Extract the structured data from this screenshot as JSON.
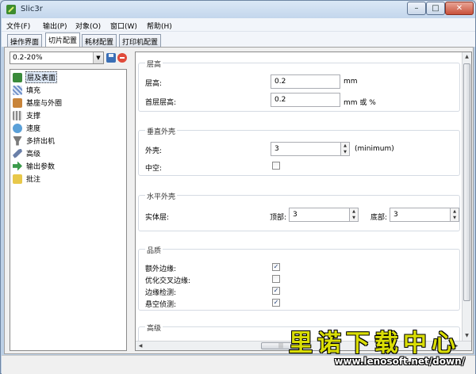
{
  "window": {
    "title": "Slic3r",
    "controls": {
      "minimize": "–",
      "maximize": "□",
      "close": "✕"
    }
  },
  "menubar": {
    "items": [
      "文件(F)",
      "输出(P)",
      "对象(O)",
      "窗口(W)",
      "帮助(H)"
    ]
  },
  "tabs": [
    "操作界面",
    "切片配置",
    "耗材配置",
    "打印机配置"
  ],
  "active_tab": "切片配置",
  "preset": {
    "value": "0.2-20%"
  },
  "page_tree": {
    "items": [
      {
        "label": "层及表面",
        "icon": "layers-icon",
        "color": "#3a8a3a"
      },
      {
        "label": "填充",
        "icon": "infill-icon",
        "color": "#6e8fc8"
      },
      {
        "label": "基座与外圈",
        "icon": "skirt-brim-icon",
        "color": "#c8843a"
      },
      {
        "label": "支撑",
        "icon": "support-icon",
        "color": "#8a8a8a"
      },
      {
        "label": "速度",
        "icon": "speed-icon",
        "color": "#5aa0d8"
      },
      {
        "label": "多挤出机",
        "icon": "extruder-icon",
        "color": "#7a7a7a"
      },
      {
        "label": "高级",
        "icon": "wrench-icon",
        "color": "#6a7fa8"
      },
      {
        "label": "输出参数",
        "icon": "output-icon",
        "color": "#3a9a4a"
      },
      {
        "label": "批注",
        "icon": "notes-icon",
        "color": "#e8c84a"
      }
    ]
  },
  "settings": {
    "layer_height": {
      "title": "层高",
      "layer_height_label": "层高:",
      "layer_height_value": "0.2",
      "layer_height_unit": "mm",
      "first_layer_label": "首层层高:",
      "first_layer_value": "0.2",
      "first_layer_unit": "mm 或 %"
    },
    "vertical_shells": {
      "title": "垂直外壳",
      "perimeters_label": "外壳:",
      "perimeters_value": "3",
      "perimeters_unit": "(minimum)",
      "hollow_label": "中空:",
      "hollow_checked": false
    },
    "horizontal_shells": {
      "title": "水平外壳",
      "solid_layers_label": "实体层:",
      "top_label": "顶部:",
      "top_value": "3",
      "bottom_label": "底部:",
      "bottom_value": "3"
    },
    "quality": {
      "title": "品质",
      "items": [
        {
          "label": "额外边缘:",
          "checked": true
        },
        {
          "label": "优化交叉边缘:",
          "checked": false
        },
        {
          "label": "边缘检测:",
          "checked": true
        },
        {
          "label": "悬空侦测:",
          "checked": true
        }
      ]
    },
    "advanced": {
      "title": "高级"
    }
  },
  "watermark": {
    "text": "里诺下载中心",
    "url": "www.lenosoft.net/down/"
  }
}
